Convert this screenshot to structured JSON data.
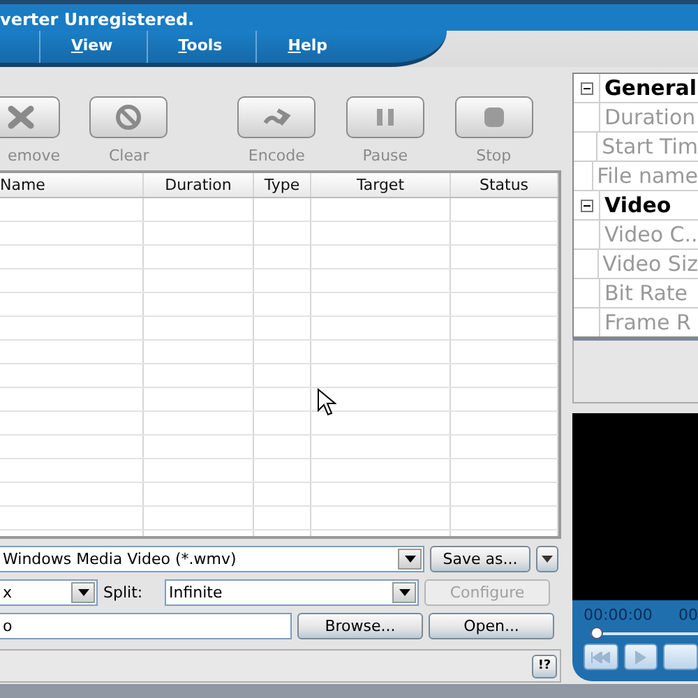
{
  "window": {
    "title": "verter Unregistered."
  },
  "menu": [
    {
      "label": "View"
    },
    {
      "label": "Tools"
    },
    {
      "label": "Help"
    }
  ],
  "toolbar": [
    {
      "label": "emove",
      "kind": "remove"
    },
    {
      "label": "Clear",
      "kind": "clear"
    },
    {
      "label": "Encode",
      "kind": "encode"
    },
    {
      "label": "Pause",
      "kind": "pause"
    },
    {
      "label": "Stop",
      "kind": "stop"
    }
  ],
  "table": {
    "columns": [
      "Name",
      "Duration",
      "Type",
      "Target",
      "Status"
    ]
  },
  "output": {
    "format": "Windows Media Video  (*.wmv)",
    "save_button": "Save as...",
    "profile": "x",
    "split_label": "Split:",
    "split": "Infinite",
    "configure_button": {
      "label": "Configure",
      "disabled": true
    },
    "folder": "o",
    "browse_button": "Browse...",
    "open_button": "Open..."
  },
  "status_bar": {
    "help_button": "!?"
  },
  "properties": [
    {
      "label": "General",
      "kind": "group",
      "expanded": true
    },
    {
      "label": "Duration",
      "kind": "item"
    },
    {
      "label": "Start Tim",
      "kind": "item"
    },
    {
      "label": "File name",
      "kind": "item"
    },
    {
      "label": "Video",
      "kind": "group",
      "expanded": true
    },
    {
      "label": "Video C..",
      "kind": "item"
    },
    {
      "label": "Video Siz",
      "kind": "item"
    },
    {
      "label": "Bit Rate",
      "kind": "item"
    },
    {
      "label": "Frame R",
      "kind": "item"
    }
  ],
  "player": {
    "time": "00:00:00",
    "time_end": "00",
    "level": 0
  }
}
